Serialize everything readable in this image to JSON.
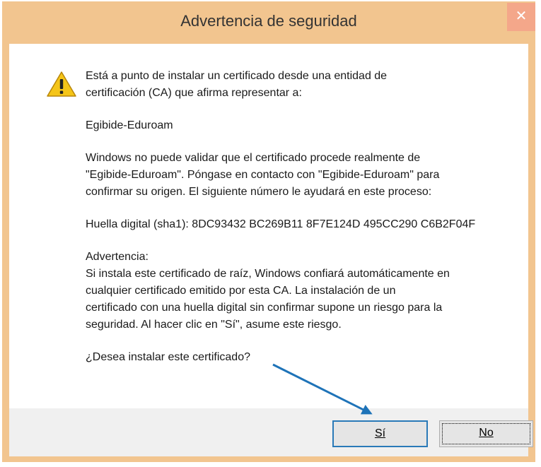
{
  "window": {
    "title": "Advertencia de seguridad",
    "close_glyph": "✕"
  },
  "message": {
    "intro": "Está a punto de instalar un certificado desde una entidad de\ncertificación (CA) que afirma representar a:",
    "entity": "Egibide-Eduroam",
    "validation": "Windows no puede validar que el certificado procede realmente de\n\"Egibide-Eduroam\". Póngase en contacto con \"Egibide-Eduroam\" para\nconfirmar su origen. El siguiente número le ayudará en este proceso:",
    "thumbprint": "Huella digital (sha1): 8DC93432 BC269B11 8F7E124D 495CC290 C6B2F04F",
    "warning_heading": "Advertencia:",
    "warning_body": "Si instala este certificado de raíz, Windows confiará automáticamente en\ncualquier certificado emitido por esta CA. La instalación de un\ncertificado con una huella digital sin confirmar supone un riesgo para la\nseguridad. Al hacer clic en \"Sí\", asume este riesgo.",
    "question": "¿Desea instalar este certificado?"
  },
  "buttons": {
    "yes": "Sí",
    "no": "No"
  },
  "icons": {
    "warning": "warning-icon",
    "close": "close-icon"
  },
  "colors": {
    "frame": "#f2c58f",
    "close": "#f4a78a",
    "annotation_arrow": "#1e73b8"
  }
}
